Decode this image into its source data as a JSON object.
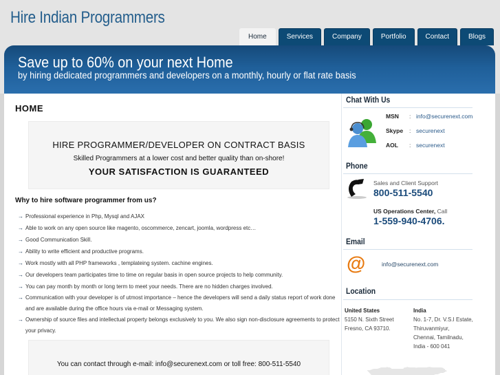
{
  "site": {
    "title": "Hire Indian Programmers"
  },
  "nav": {
    "tabs": [
      {
        "label": "Home",
        "active": true
      },
      {
        "label": "Services",
        "active": false
      },
      {
        "label": "Company",
        "active": false
      },
      {
        "label": "Portfolio",
        "active": false
      },
      {
        "label": "Contact",
        "active": false
      },
      {
        "label": "Blogs",
        "active": false
      }
    ]
  },
  "banner": {
    "headline": "Save up to 60% on your next Home",
    "subline": "by hiring dedicated programmers and developers on a monthly, hourly or flat rate basis"
  },
  "main": {
    "page_title": "HOME",
    "promo": {
      "line1": "HIRE PROGRAMMER/DEVELOPER ON CONTRACT BASIS",
      "line2": "Skilled Programmers at a lower cost and better quality than on-shore!",
      "line3": "YOUR SATISFACTION IS GUARANTEED"
    },
    "why_heading": "Why to hire software programmer from us?",
    "benefits": [
      "Professional experience in Php, Mysql and AJAX",
      "Able to work on any open source like magento, oscommerce, zencart, joomla, wordpress etc…",
      "Good Communication Skill.",
      "Ability to write efficient and productive programs.",
      "Work mostly with all PHP frameworks , templateing system. cachine engines.",
      "Our developers team participates time to time on regular basis in open source projects to help community.",
      "You can pay month by month or long term to meet your needs. There are no hidden charges involved.",
      "Communication with your developer is of utmost importance – hence the developers will send a daily status report of work done and are available during the office hours via e-mail or Messaging system.",
      "Ownership of source files and intellectual property belongs exclusively to you. We also sign non-disclosure agreements to protect your privacy."
    ],
    "contact_line": "You can contact through e-mail: info@securenext.com or toll free: 800-511-5540"
  },
  "sidebar": {
    "chat": {
      "heading": "Chat With Us",
      "rows": [
        {
          "key": "MSN",
          "sep": ":",
          "value": "info@securenext.com"
        },
        {
          "key": "Skype",
          "sep": ":",
          "value": "securenext"
        },
        {
          "key": "AOL",
          "sep": ":",
          "value": "securenext"
        }
      ]
    },
    "phone": {
      "heading": "Phone",
      "sales_label": "Sales and Client Support",
      "sales_number": "800-511-5540",
      "ops_label_bold": "US Operations Center,",
      "ops_label_rest": " Call",
      "ops_number": "1-559-940-4706."
    },
    "email": {
      "heading": "Email",
      "address": "info@securenext.com"
    },
    "location": {
      "heading": "Location",
      "us": {
        "country": "United States",
        "lines": [
          "5150 N. Sixth Street",
          "Fresno, CA 93710."
        ]
      },
      "india": {
        "country": "India",
        "lines": [
          "No. 1-7, Dr. V.S.I Estate,",
          "Thiruvanmiyur,",
          "Chennai, Tamilnadu,",
          "India - 600 041"
        ]
      }
    }
  },
  "colors": {
    "brand_blue": "#245e8c",
    "tab_blue": "#0d4a75",
    "link_blue": "#2a5a8a",
    "phone_blue": "#1a4a7a"
  }
}
